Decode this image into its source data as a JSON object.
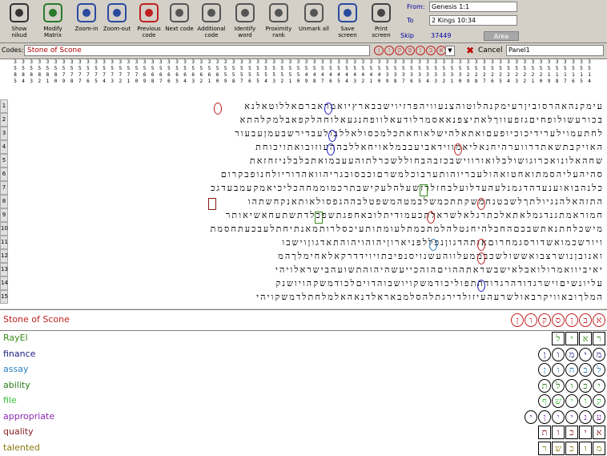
{
  "toolbar": {
    "buttons": [
      {
        "label": "Show nikud",
        "name": "show-nikud-button",
        "icon": "show-nikud-icon"
      },
      {
        "label": "Modify Matrix",
        "name": "modify-matrix-button",
        "icon": "matrix-icon"
      },
      {
        "label": "Zoom-in",
        "name": "zoom-in-button",
        "icon": "zoom-in-icon"
      },
      {
        "label": "Zoom-out",
        "name": "zoom-out-button",
        "icon": "zoom-out-icon"
      },
      {
        "label": "Previous code",
        "name": "previous-code-button",
        "icon": "previous-code-icon"
      },
      {
        "label": "Next code",
        "name": "next-code-button",
        "icon": "next-code-icon"
      },
      {
        "label": "Additional code",
        "name": "additional-code-button",
        "icon": "additional-code-icon"
      },
      {
        "label": "Identify word",
        "name": "identify-word-button",
        "icon": "identify-word-icon"
      },
      {
        "label": "Proximity rank",
        "name": "proximity-rank-button",
        "icon": "proximity-rank-icon"
      },
      {
        "label": "Unmark all",
        "name": "unmark-all-button",
        "icon": "unmark-icon"
      },
      {
        "label": "Save screen",
        "name": "save-screen-button",
        "icon": "save-icon"
      },
      {
        "label": "Print screen",
        "name": "print-screen-button",
        "icon": "printer-icon"
      }
    ],
    "from_label": "From:",
    "from_value": "Genesis 1:1",
    "to_label": "To",
    "to_value": "2 Kings 10:34",
    "skip_label": "Skip",
    "skip_value": "37449",
    "area_label": "Area"
  },
  "codes": {
    "label": "Codes:",
    "value": "Stone of Scone",
    "cancel_label": "Cancel",
    "panel_label": "Panel1",
    "circle_letters": [
      "א",
      "ב",
      "ן",
      "ס",
      "ק",
      "ו",
      "ן"
    ]
  },
  "grid": {
    "col_numbers": [
      "3\n5\n8\n5",
      "3\n5\n8\n4",
      "3\n5\n8\n3",
      "3\n5\n8\n2",
      "3\n5\n8\n1",
      "3\n5\n8\n0",
      "3\n5\n7\n9",
      "3\n5\n7\n8",
      "3\n5\n7\n7",
      "3\n5\n7\n6",
      "3\n5\n7\n5",
      "3\n5\n7\n4",
      "3\n5\n7\n3",
      "3\n5\n7\n2",
      "3\n5\n7\n1",
      "3\n5\n7\n0",
      "3\n5\n6\n9",
      "3\n5\n6\n8",
      "3\n5\n6\n7",
      "3\n5\n6\n6",
      "3\n5\n6\n5",
      "3\n5\n6\n4",
      "3\n5\n6\n3",
      "3\n5\n6\n2",
      "3\n5\n6\n1",
      "3\n5\n6\n0",
      "3\n5\n5\n9",
      "3\n5\n5\n8",
      "3\n5\n5\n7",
      "3\n5\n5\n6",
      "3\n5\n5\n5",
      "3\n5\n5\n4",
      "3\n5\n5\n3",
      "3\n5\n5\n2",
      "3\n5\n5\n1",
      "3\n5\n5\n0",
      "3\n5\n4\n9",
      "3\n5\n4\n8",
      "3\n5\n4\n7",
      "3\n5\n4\n6",
      "3\n5\n4\n5",
      "3\n5\n4\n4",
      "3\n5\n4\n3",
      "3\n5\n4\n2",
      "3\n5\n4\n1",
      "3\n5\n4\n0",
      "3\n5\n3\n9",
      "3\n5\n3\n8",
      "3\n5\n3\n7",
      "3\n5\n3\n6",
      "3\n5\n3\n5",
      "3\n5\n3\n4",
      "3\n5\n3\n3",
      "3\n5\n3\n2",
      "3\n5\n3\n1",
      "3\n5\n3\n0",
      "3\n5\n2\n9",
      "3\n5\n2\n8",
      "3\n5\n2\n7",
      "3\n5\n2\n6",
      "3\n5\n2\n5",
      "3\n5\n2\n4",
      "3\n5\n2\n3",
      "3\n5\n2\n2",
      "3\n5\n2\n1",
      "3\n5\n2\n0",
      "3\n5\n1\n9",
      "3\n5\n1\n8",
      "3\n5\n1\n7",
      "3\n5\n1\n6",
      "3\n5\n1\n5",
      "3\n5\n1\n4"
    ],
    "rows": [
      {
        "num": "1",
        "text": "עימקנהאהרסוביןרעימקנהלוטוהצנעוויהפרזיוישבבארץיואמראברםאללוטאלנא"
      },
      {
        "num": "2",
        "text": "בכורעשולופחיםגזפעווךלאתיצפנאאסמרלודעאלוופחנגעאלוחהלקפאבלמקלהתא"
      },
      {
        "num": "3",
        "text": "לחתעמוילערידיכוכיופעםואתאלהישלאוחאתכלמכסולאללבולעבדירשבעמןעבעור"
      },
      {
        "num": "4",
        "text": "האויקבתשאתדרווערהיחנאליאמווידאביעבבמלאויחאללבההעוזובואתויכוחת"
      },
      {
        "num": "5",
        "text": "שחהאלונואכרוגושולבלואורווישבכזבהבחוללשכרלתוהעעבמואתבלבלניזחזאת"
      },
      {
        "num": "6",
        "text": "סהיהעליהסמתואחטואהולעבריוהותערבוכלמשרםוכבסובגריהוואהדוריולחנופבקרום"
      },
      {
        "num": "7",
        "text": "כלנהבואוענעדהדגמנלעהעדלועלבחזלרזשעלהלעקישבתרכמוממחהכליכיאמקעמבעדגכ"
      },
      {
        "num": "8",
        "text": "התזהאלהנגיולתךלשבטנחמשקתתכמשלבמטהמשפטלבההגפסולאותאנקחשתהו"
      },
      {
        "num": "9",
        "text": "חמוראמתגנדגמלאתאלכתרגלאלשראלתכעמודיתלובאחפגתשפכלדתשתעחאשיאותר"
      },
      {
        "num": "10",
        "text": "מישכלחתנאתשבכםהחבלהיחנטלהלמתכמתלעומתותעיכסלרותמאנתיחתלעבכעתחסמת"
      },
      {
        "num": "11",
        "text": "ויורשכמואשדורסגמחרוםאותהדגוןנפללפניארוןיהוהויהוהתאדגוןוישבו"
      },
      {
        "num": "12",
        "text": "ואנובןנושרצבואששולשכבממעלווהעשנויסנפיבתויוידדרקאלאחימלךהמ"
      },
      {
        "num": "13",
        "text": "יאיביוואמרולואבלאישבשראתההויםהזהכייעשהיהוהתשועהבישראלויהי"
      },
      {
        "num": "14",
        "text": "עליונשיםוישרגדודהרגדודהתפוליכודמשקויושבוהדויםלכודמשקהויושנק"
      },
      {
        "num": "15",
        "text": "המלךובאוויקרבאולשרעהעיזולדירגתלהסלמבאראלדנאהאלמלחתלדמשקויהי"
      }
    ]
  },
  "bottom": {
    "search_term": "Stone of Scone",
    "search_term_letters": [
      "א",
      "ב",
      "ן",
      "ס",
      "ק",
      "ו",
      "ן"
    ],
    "terms": [
      {
        "label": "RayEl",
        "color": "#3a8a1a",
        "letters": [
          "ר",
          "א",
          "י",
          "ל"
        ]
      },
      {
        "label": "finance",
        "color": "#1a1a80",
        "letters": [
          "מ",
          "י",
          "מ",
          "ו",
          "ן"
        ]
      },
      {
        "label": "assay",
        "color": "#2a80c0",
        "letters": [
          "ל",
          "ב",
          "ח",
          "ו",
          "ן"
        ]
      },
      {
        "label": "ability",
        "color": "#2a7a1a",
        "letters": [
          "י",
          "כ",
          "ו",
          "ל",
          "ת"
        ]
      },
      {
        "label": "file",
        "color": "#3ac03a",
        "letters": [
          "ק",
          "ו",
          "י",
          "ש",
          "ף"
        ]
      },
      {
        "label": "appropriate",
        "color": "#8a2ab0",
        "letters": [
          "ע",
          "נ",
          "י",
          "י",
          "ן",
          "י"
        ]
      },
      {
        "label": "quality",
        "color": "#8a1a1a",
        "letters": [
          "א",
          "י",
          "כ",
          "ו",
          "ת"
        ]
      },
      {
        "label": "talented",
        "color": "#8a7a0a",
        "letters": [
          "מ",
          "ו",
          "כ",
          "ש",
          "ר"
        ]
      }
    ]
  }
}
